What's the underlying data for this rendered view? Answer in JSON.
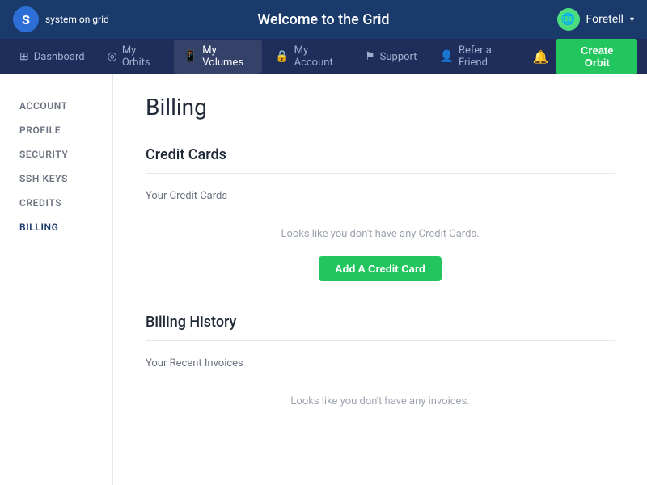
{
  "topBar": {
    "logoLine1": "system on grid",
    "pageTitle": "Welcome to the Grid",
    "userName": "Foretell",
    "userAvatarIcon": "🌐",
    "chevronIcon": "▾"
  },
  "secondaryNav": {
    "items": [
      {
        "id": "dashboard",
        "label": "Dashboard",
        "icon": "⊞"
      },
      {
        "id": "my-orbits",
        "label": "My Orbits",
        "icon": "◎"
      },
      {
        "id": "my-volumes",
        "label": "My Volumes",
        "icon": "📱",
        "active": true
      },
      {
        "id": "my-account",
        "label": "My Account",
        "icon": "🔒"
      },
      {
        "id": "support",
        "label": "Support",
        "icon": "⚑"
      },
      {
        "id": "refer-friend",
        "label": "Refer a Friend",
        "icon": "👤"
      }
    ],
    "createOrbitLabel": "Create Orbit",
    "notificationIcon": "🔔"
  },
  "sidebar": {
    "items": [
      {
        "id": "account",
        "label": "ACCOUNT"
      },
      {
        "id": "profile",
        "label": "PROFILE"
      },
      {
        "id": "security",
        "label": "SECURITY"
      },
      {
        "id": "ssh-keys",
        "label": "SSH KEYS"
      },
      {
        "id": "credits",
        "label": "CREDITS"
      },
      {
        "id": "billing",
        "label": "BILLING",
        "active": true
      }
    ]
  },
  "content": {
    "pageHeading": "Billing",
    "creditCards": {
      "sectionTitle": "Credit Cards",
      "subTitle": "Your Credit Cards",
      "emptyMessage": "Looks like you don't have any Credit Cards.",
      "addCardLabel": "Add A Credit Card"
    },
    "billingHistory": {
      "sectionTitle": "Billing History",
      "subTitle": "Your Recent Invoices",
      "emptyMessage": "Looks like you don't have any invoices."
    }
  }
}
